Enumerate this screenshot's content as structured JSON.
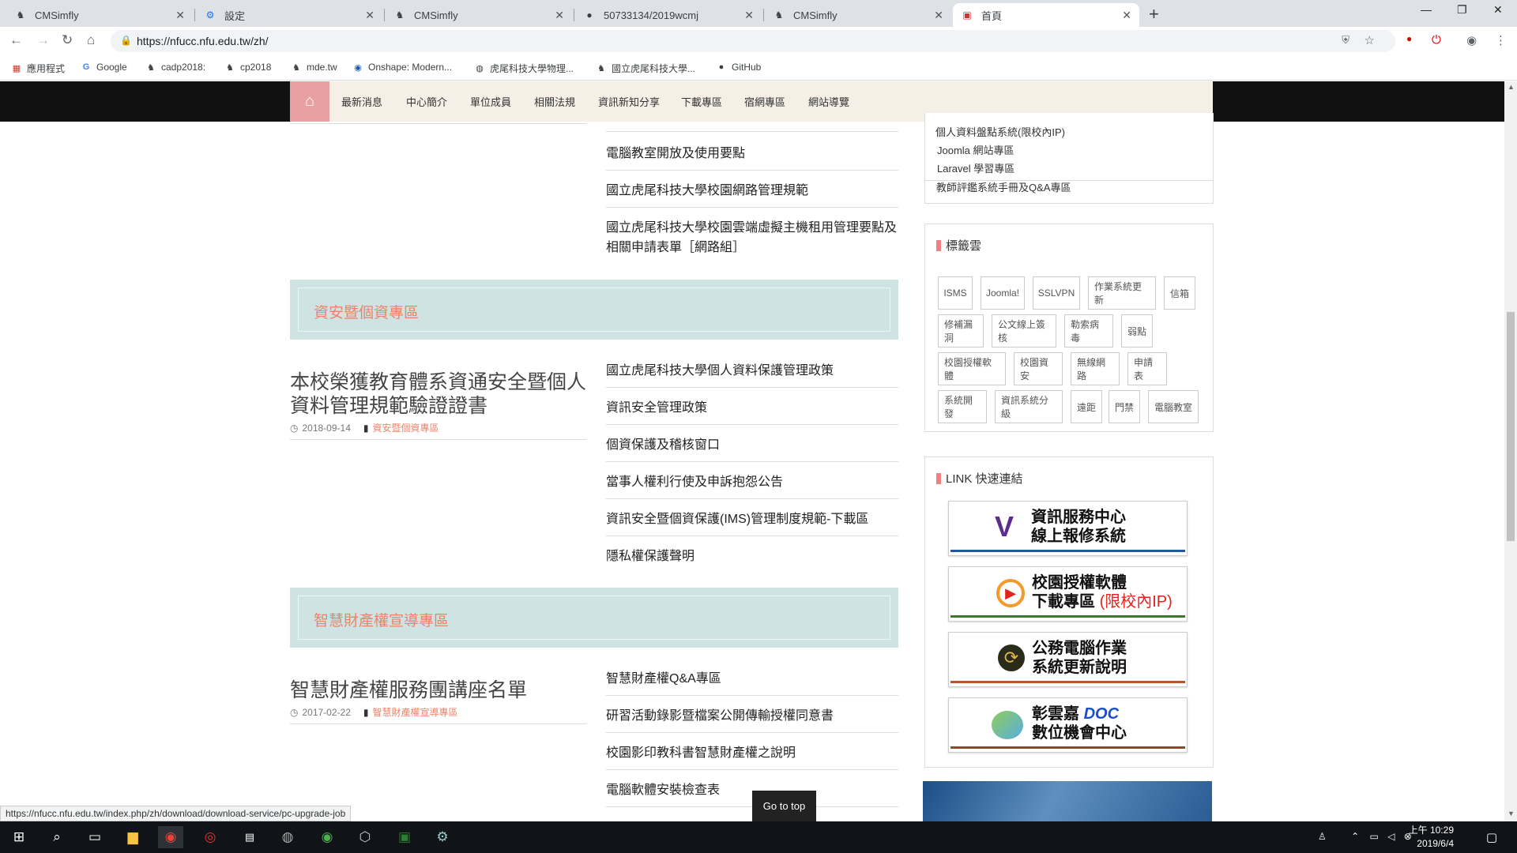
{
  "browser": {
    "tabs": [
      {
        "title": "CMSimfly",
        "icon": "cmsimfly-icon"
      },
      {
        "title": "設定",
        "icon": "settings-gear-icon"
      },
      {
        "title": "CMSimfly",
        "icon": "cmsimfly-icon"
      },
      {
        "title": "50733134/2019wcmj",
        "icon": "github-icon"
      },
      {
        "title": "CMSimfly",
        "icon": "cmsimfly-icon"
      },
      {
        "title": "首頁",
        "icon": "nfu-icon",
        "active": true
      }
    ],
    "url": "https://nfucc.nfu.edu.tw/zh/",
    "bookmarks": [
      "應用程式",
      "Google",
      "cadp2018:",
      "cp2018",
      "mde.tw",
      "Onshape: Modern...",
      "虎尾科技大學物理...",
      "國立虎尾科技大學...",
      "GitHub"
    ]
  },
  "site_nav": {
    "items": [
      "最新消息",
      "中心簡介",
      "單位成員",
      "相關法規",
      "資訊新知分享",
      "下載專區",
      "宿網專區",
      "網站導覽"
    ]
  },
  "section_top": {
    "links": [
      "電腦教室開放及使用要點",
      "國立虎尾科技大學校園網路管理規範",
      "國立虎尾科技大學校園雲端虛擬主機租用管理要點及相關申請表單［網路組］"
    ]
  },
  "section_security": {
    "title": "資安暨個資專區",
    "post_title": "本校榮獲教育體系資通安全暨個人資料管理規範驗證證書",
    "post_date": "2018-09-14",
    "post_category": "資安暨個資專區",
    "links": [
      "國立虎尾科技大學個人資料保護管理政策",
      "資訊安全管理政策",
      "個資保護及稽核窗口",
      "當事人權利行使及申訴抱怨公告",
      "資訊安全暨個資保護(IMS)管理制度規範-下載區",
      "隱私權保護聲明"
    ]
  },
  "section_ip": {
    "title": "智慧財產權宣導專區",
    "post_title": "智慧財產權服務團講座名單",
    "post_date": "2017-02-22",
    "post_category": "智慧財產權宣導專區",
    "links": [
      "智慧財產權Q&A專區",
      "研習活動錄影暨檔案公開傳輸授權同意書",
      "校園影印教科書智慧財產權之說明",
      "電腦軟體安裝檢查表"
    ]
  },
  "sidebar": {
    "top_links": [
      "個人資料盤點系統(限校內IP)",
      "Joomla 網站專區",
      "Laravel 學習專區",
      "教師評鑑系統手冊及Q&A專區"
    ],
    "tag_title": "標籤雲",
    "tags": [
      "ISMS",
      "Joomla!",
      "SSLVPN",
      "作業系統更新",
      "信箱",
      "修補漏洞",
      "公文線上簽核",
      "勒索病毒",
      "弱點",
      "校園授權軟體",
      "校園資安",
      "無線網路",
      "申請表",
      "系統開發",
      "資訊系統分級",
      "遠距",
      "門禁",
      "電腦教室"
    ],
    "link_title": "LINK 快速連結",
    "quick_links": [
      {
        "line1": "資訊服務中心",
        "line2": "線上報修系統",
        "extra": ""
      },
      {
        "line1": "校園授權軟體",
        "line2": "下載專區",
        "extra": "(限校內IP)"
      },
      {
        "line1": "公務電腦作業",
        "line2": "系統更新說明",
        "extra": ""
      },
      {
        "line1": "彰雲嘉",
        "line2": "數位機會中心",
        "extra": "DOC"
      }
    ]
  },
  "go_top": "Go to top",
  "status_url": "https://nfucc.nfu.edu.tw/index.php/zh/download/download-service/pc-upgrade-job",
  "taskbar": {
    "time": "上午 10:29",
    "date": "2019/6/4"
  },
  "colors": {
    "accent": "#e9846a",
    "banner": "#cfe3e3",
    "nav_bg": "#f5efe6",
    "home": "#e8a0a0"
  }
}
